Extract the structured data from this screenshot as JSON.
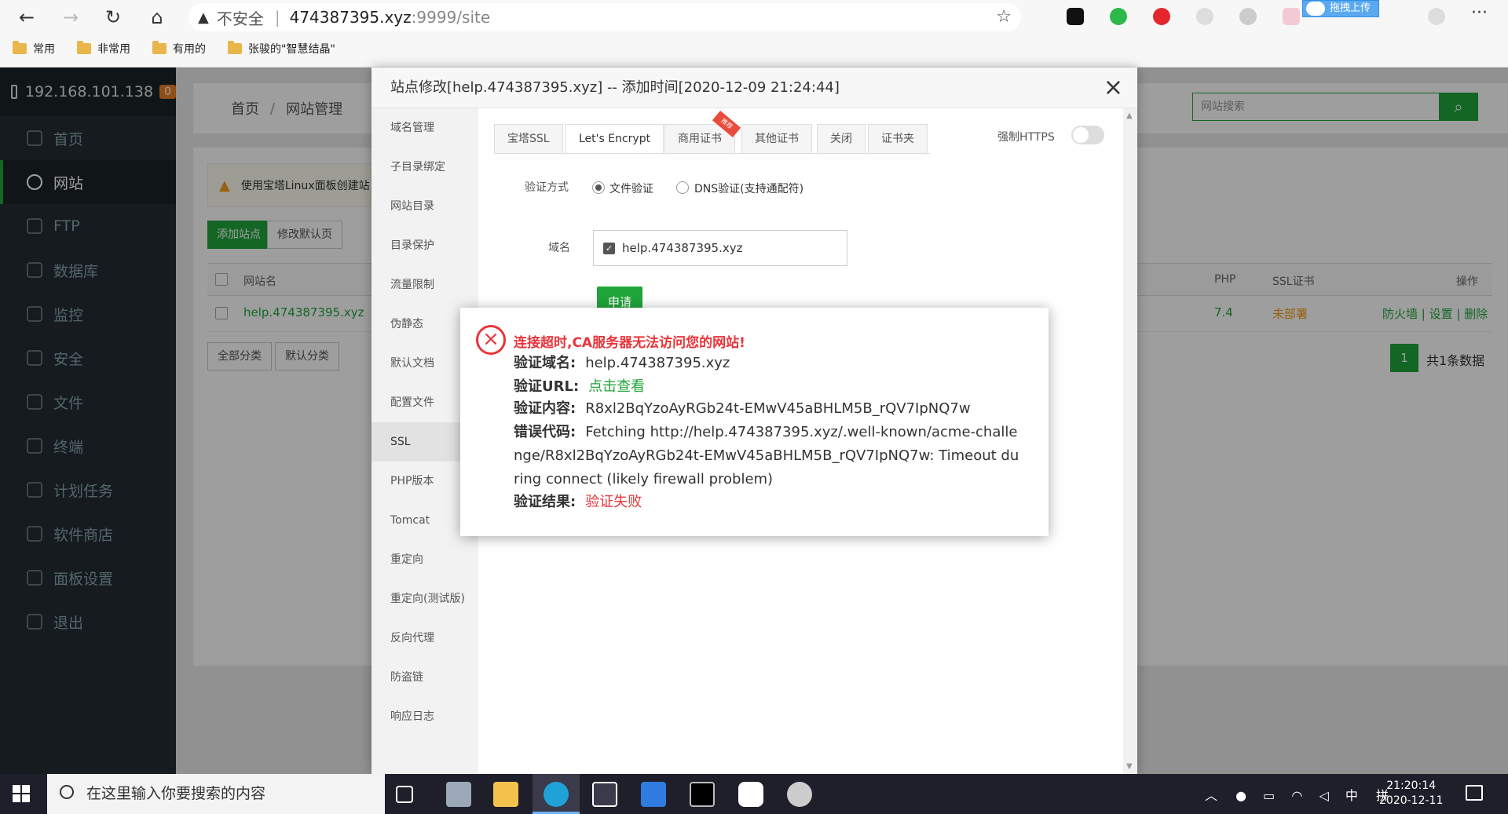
{
  "browser": {
    "insecure_label": "不安全",
    "url_host": "474387395.xyz",
    "url_path": ":9999/site",
    "upload_badge": "拖拽上传",
    "bookmarks": [
      "常用",
      "非常用",
      "有用的",
      "张骏的\"智慧结晶\""
    ]
  },
  "sidebar": {
    "server_ip": "192.168.101.138",
    "alert_count": "0",
    "items": [
      "首页",
      "网站",
      "FTP",
      "数据库",
      "监控",
      "安全",
      "文件",
      "终端",
      "计划任务",
      "软件商店",
      "面板设置",
      "退出"
    ],
    "active_index": 1
  },
  "page": {
    "breadcrumb_home": "首页",
    "breadcrumb_sep": "/",
    "breadcrumb_current": "网站管理",
    "search_placeholder": "网站搜索",
    "alert_text": "使用宝塔Linux面板创建站",
    "add_site_btn": "添加站点",
    "edit_default_btn": "修改默认页",
    "col_site": "网站名",
    "col_php": "PHP",
    "col_ssl": "SSL证书",
    "col_actions": "操作",
    "row_site": "help.474387395.xyz",
    "row_php": "7.4",
    "row_ssl": "未部署",
    "row_firewall": "防火墙",
    "row_settings": "设置",
    "row_delete": "删除",
    "all_categories_btn": "全部分类",
    "default_category_btn": "默认分类",
    "page_number": "1",
    "total_text": "共1条数据"
  },
  "modal": {
    "title": "站点修改[help.474387395.xyz] -- 添加时间[2020-12-09 21:24:44]",
    "nav": [
      "域名管理",
      "子目录绑定",
      "网站目录",
      "目录保护",
      "流量限制",
      "伪静态",
      "默认文档",
      "配置文件",
      "SSL",
      "PHP版本",
      "Tomcat",
      "重定向",
      "重定向(测试版)",
      "反向代理",
      "防盗链",
      "响应日志"
    ],
    "active_nav": 8,
    "tabs": [
      "宝塔SSL",
      "Let's Encrypt",
      "商用证书",
      "其他证书",
      "关闭",
      "证书夹"
    ],
    "active_tab": 1,
    "ribbon": "推荐",
    "force_https": "强制HTTPS",
    "verify_label": "验证方式",
    "file_verify": "文件验证",
    "dns_verify": "DNS验证(支持通配符)",
    "domain_label": "域名",
    "domain_value": "help.474387395.xyz",
    "apply_btn": "申请"
  },
  "error": {
    "title": "连接超时,CA服务器无法访问您的网站!",
    "domain_label": "验证域名:",
    "domain_value": "help.474387395.xyz",
    "url_label": "验证URL:",
    "url_value": "点击查看",
    "content_label": "验证内容:",
    "content_value": "R8xl2BqYzoAyRGb24t-EMwV45aBHLM5B_rQV7IpNQ7w",
    "code_label": "错误代码:",
    "code_value": "Fetching http://help.474387395.xyz/.well-known/acme-challenge/R8xl2BqYzoAyRGb24t-EMwV45aBHLM5B_rQV7IpNQ7w: Timeout during connect (likely firewall problem)",
    "result_label": "验证结果:",
    "result_value": "验证失败"
  },
  "taskbar": {
    "search_placeholder": "在这里输入你要搜索的内容",
    "ime_lang": "中",
    "ime_mode": "拼",
    "time": "21:20:14",
    "date": "2020-12-11"
  },
  "colors": {
    "accent": "#20a53a",
    "error": "#e8353a",
    "sidebar_bg": "#222d32"
  }
}
